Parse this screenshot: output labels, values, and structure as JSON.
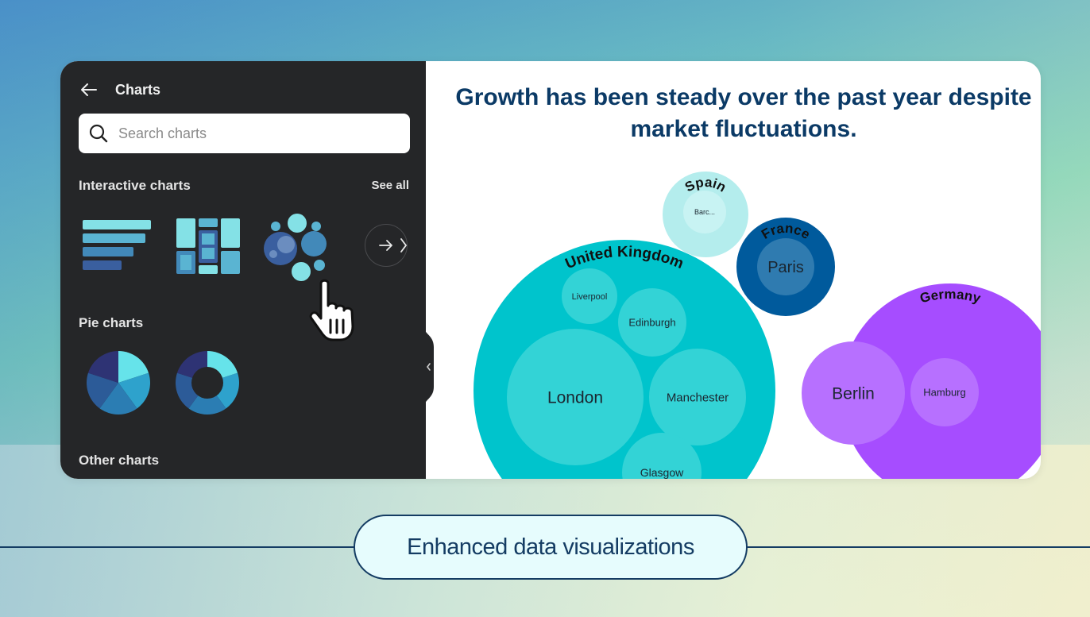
{
  "panel": {
    "title": "Charts",
    "search": {
      "placeholder": "Search charts",
      "value": ""
    },
    "sections": [
      {
        "label": "Interactive charts",
        "see_all": "See all",
        "thumbnails": [
          "bar-chart",
          "treemap-chart",
          "bubble-chart"
        ]
      },
      {
        "label": "Pie charts",
        "thumbnails": [
          "pie-chart",
          "donut-chart"
        ]
      },
      {
        "label": "Other charts"
      }
    ]
  },
  "headline": "Growth has been steady over the past year despite market fluctuations.",
  "caption": "Enhanced data visualizations",
  "colors": {
    "panel_bg": "#252628",
    "headline": "#0b3a66",
    "uk": "#00c4cc",
    "uk_inner": "#33d3d6",
    "germany": "#a64dff",
    "germany_inner": "#b770ff",
    "france": "#005a9c",
    "france_inner": "#2f7bb0",
    "spain": "#b4eded",
    "spain_inner": "#c8f3f3",
    "caption_border": "#143c63"
  },
  "chart_data": {
    "type": "bubble",
    "title": "Growth has been steady over the past year despite market fluctuations.",
    "groups": [
      {
        "name": "United Kingdom",
        "color": "#00c4cc",
        "inner_color": "#33d3d6",
        "children": [
          {
            "name": "London"
          },
          {
            "name": "Manchester"
          },
          {
            "name": "Edinburgh"
          },
          {
            "name": "Liverpool"
          },
          {
            "name": "Glasgow"
          }
        ]
      },
      {
        "name": "Germany",
        "color": "#a64dff",
        "inner_color": "#b770ff",
        "children": [
          {
            "name": "Berlin"
          },
          {
            "name": "Hamburg"
          }
        ]
      },
      {
        "name": "France",
        "color": "#005a9c",
        "inner_color": "#2f7bb0",
        "children": [
          {
            "name": "Paris"
          }
        ]
      },
      {
        "name": "Spain",
        "color": "#b4eded",
        "inner_color": "#c8f3f3",
        "children": [
          {
            "name": "Barc..."
          }
        ]
      }
    ]
  }
}
